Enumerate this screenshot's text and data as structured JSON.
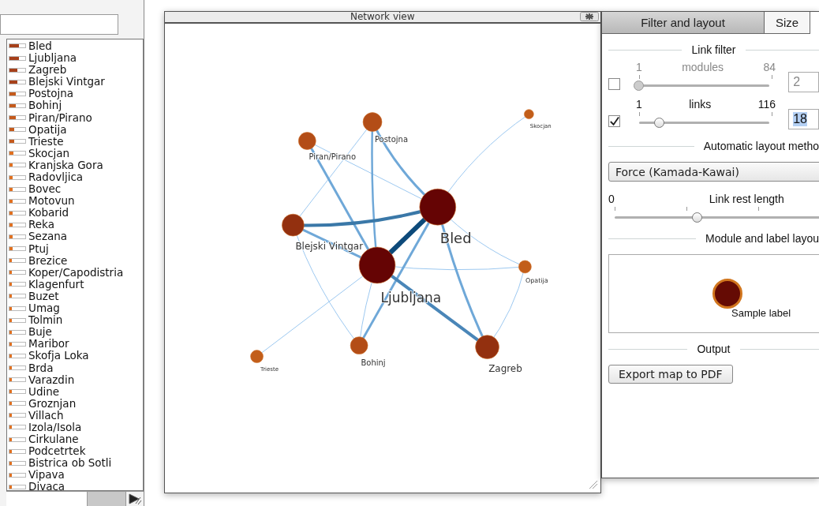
{
  "places": [
    {
      "label": "Bled",
      "level": 0.6
    },
    {
      "label": "Ljubljana",
      "level": 0.6
    },
    {
      "label": "Zagreb",
      "level": 0.5
    },
    {
      "label": "Blejski Vintgar",
      "level": 0.5
    },
    {
      "label": "Postojna",
      "level": 0.4
    },
    {
      "label": "Bohinj",
      "level": 0.4
    },
    {
      "label": "Piran/Pirano",
      "level": 0.4
    },
    {
      "label": "Opatija",
      "level": 0.3
    },
    {
      "label": "Trieste",
      "level": 0.3
    },
    {
      "label": "Skocjan",
      "level": 0.25
    },
    {
      "label": "Kranjska Gora",
      "level": 0.2
    },
    {
      "label": "Radovljica",
      "level": 0.2
    },
    {
      "label": "Bovec",
      "level": 0.2
    },
    {
      "label": "Motovun",
      "level": 0.2
    },
    {
      "label": "Kobarid",
      "level": 0.2
    },
    {
      "label": "Reka",
      "level": 0.2
    },
    {
      "label": "Sezana",
      "level": 0.2
    },
    {
      "label": "Ptuj",
      "level": 0.2
    },
    {
      "label": "Brezice",
      "level": 0.15
    },
    {
      "label": "Koper/Capodistria",
      "level": 0.15
    },
    {
      "label": "Klagenfurt",
      "level": 0.15
    },
    {
      "label": "Buzet",
      "level": 0.15
    },
    {
      "label": "Umag",
      "level": 0.15
    },
    {
      "label": "Tolmin",
      "level": 0.15
    },
    {
      "label": "Buje",
      "level": 0.15
    },
    {
      "label": "Maribor",
      "level": 0.15
    },
    {
      "label": "Skofja Loka",
      "level": 0.15
    },
    {
      "label": "Brda",
      "level": 0.15
    },
    {
      "label": "Varazdin",
      "level": 0.15
    },
    {
      "label": "Udine",
      "level": 0.15
    },
    {
      "label": "Groznjan",
      "level": 0.15
    },
    {
      "label": "Villach",
      "level": 0.15
    },
    {
      "label": "Izola/Isola",
      "level": 0.15
    },
    {
      "label": "Cirkulane",
      "level": 0.15
    },
    {
      "label": "Podcetrtek",
      "level": 0.15
    },
    {
      "label": "Bistrica ob Sotli",
      "level": 0.15
    },
    {
      "label": "Vipava",
      "level": 0.15
    },
    {
      "label": "Divaca",
      "level": 0.15
    }
  ],
  "network_view": {
    "title": "Network view",
    "nodes": [
      {
        "label": "Bled"
      },
      {
        "label": "Ljubljana"
      },
      {
        "label": "Zagreb"
      },
      {
        "label": "Blejski Vintgar"
      },
      {
        "label": "Postojna"
      },
      {
        "label": "Piran/Pirano"
      },
      {
        "label": "Bohinj"
      },
      {
        "label": "Opatija"
      },
      {
        "label": "Trieste"
      },
      {
        "label": "Skocjan"
      }
    ]
  },
  "tabs": [
    {
      "label": "Filter and layout",
      "selected": true
    },
    {
      "label": "Size",
      "selected": false
    }
  ],
  "link_filter": {
    "title": "Link filter",
    "rows": [
      {
        "min": "1",
        "name": "modules",
        "max": "84",
        "checked": false,
        "disabled": true,
        "level": 0.0,
        "value": "2",
        "value_selected": false
      },
      {
        "min": "1",
        "name": "links",
        "max": "116",
        "checked": true,
        "disabled": false,
        "level": 0.15,
        "value": "18",
        "value_selected": true
      }
    ]
  },
  "layout": {
    "title": "Automatic layout metho",
    "method": "Force (Kamada-Kawai)",
    "rest_length": {
      "min": "0",
      "label": "Link rest length",
      "level": 0.35
    }
  },
  "module_layout": {
    "title": "Module and label layou",
    "sample_label": "Sample label"
  },
  "output": {
    "title": "Output",
    "button": "Export map to PDF"
  }
}
